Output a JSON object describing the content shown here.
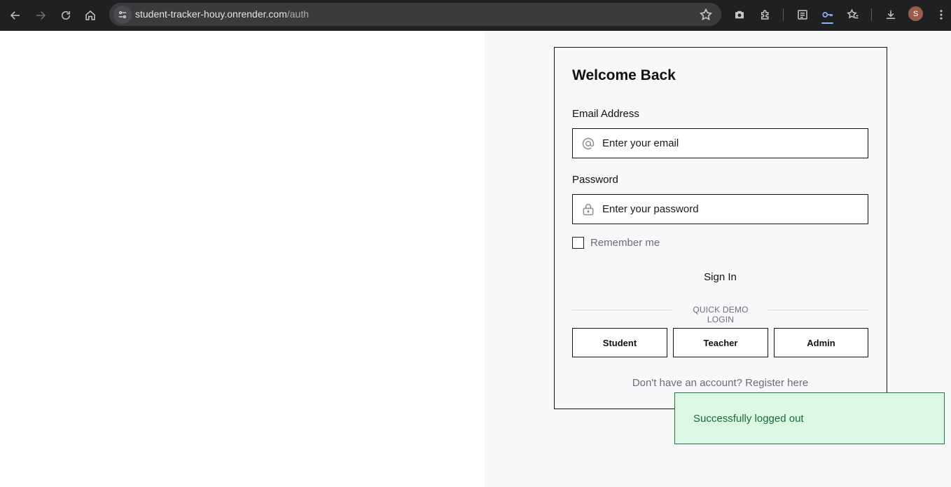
{
  "browser": {
    "url_host": "student-tracker-houy.onrender.com",
    "url_path": "/auth",
    "profile_initial": "S",
    "icons": {
      "back": "arrow-left-icon",
      "forward": "arrow-right-icon",
      "reload": "reload-icon",
      "home": "home-icon",
      "site_info": "tune-icon",
      "bookmark": "star-icon",
      "screenshot": "camera-icon",
      "extensions": "puzzle-icon",
      "reading_list": "reading-list-icon",
      "passwords": "key-icon",
      "favorites": "star-list-icon",
      "downloads": "download-icon",
      "menu": "kebab-menu-icon"
    }
  },
  "login": {
    "title": "Welcome Back",
    "email_label": "Email Address",
    "email_placeholder": "Enter your email",
    "email_icon": "at-sign-icon",
    "password_label": "Password",
    "password_placeholder": "Enter your password",
    "password_icon": "lock-icon",
    "remember_label": "Remember me",
    "remember_checked": false,
    "signin_label": "Sign In",
    "divider_label": "QUICK DEMO LOGIN",
    "demo_buttons": [
      "Student",
      "Teacher",
      "Admin"
    ],
    "register_text": "Don't have an account? Register here"
  },
  "toast": {
    "message": "Successfully logged out",
    "color": "#dcf7e3"
  }
}
